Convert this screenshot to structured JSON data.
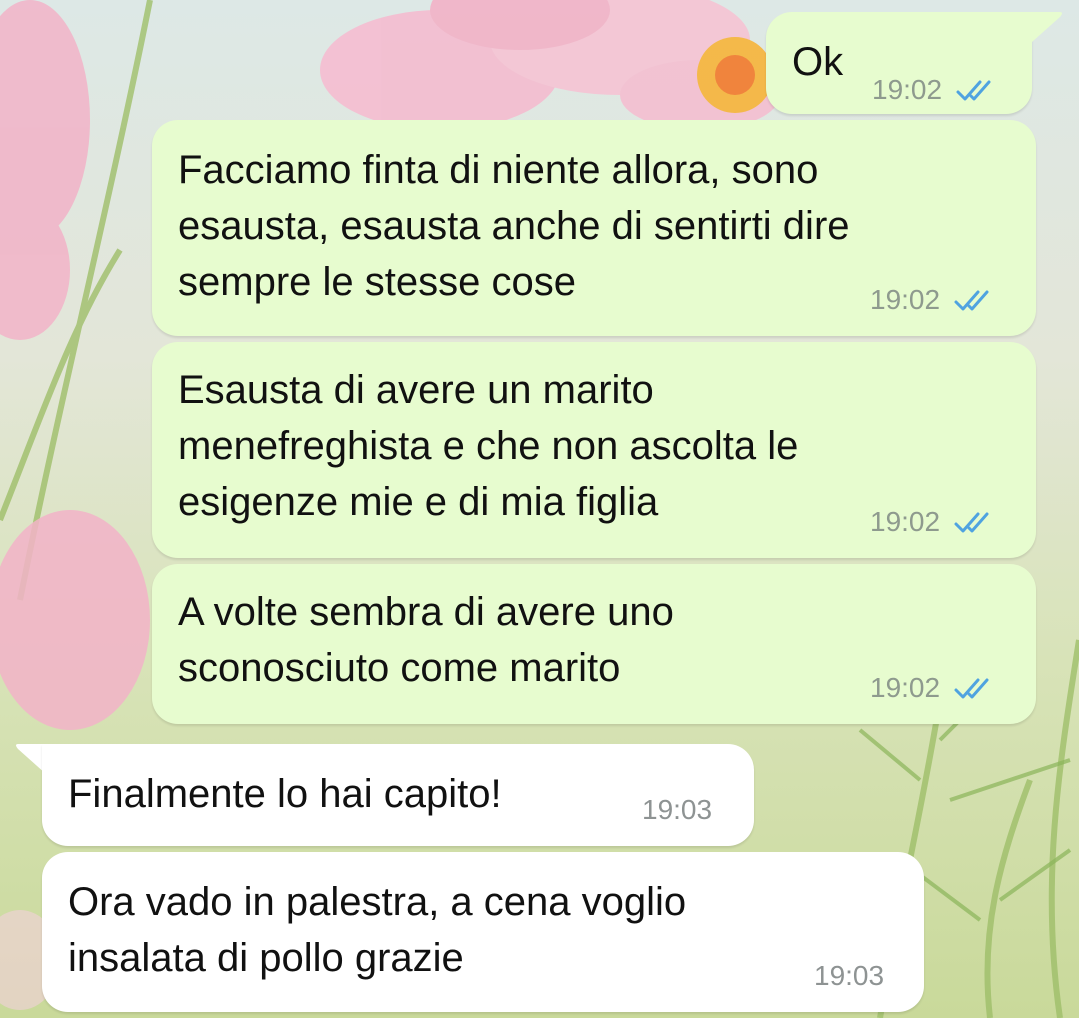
{
  "theme": {
    "outgoing_bubble": "#e7fccf",
    "incoming_bubble": "#ffffff",
    "read_ticks": "#4fa3e0"
  },
  "messages": [
    {
      "direction": "outgoing",
      "text": "Ok",
      "time": "19:02",
      "status": "read",
      "status_icon": "double-check-icon"
    },
    {
      "direction": "outgoing",
      "text": "Facciamo finta di niente allora, sono\nesausta, esausta anche di sentirti dire\nsempre le stesse cose",
      "time": "19:02",
      "status": "read",
      "status_icon": "double-check-icon"
    },
    {
      "direction": "outgoing",
      "text": "Esausta di avere un marito\nmenefreghista e che non ascolta le\nesigenze mie e di mia figlia",
      "time": "19:02",
      "status": "read",
      "status_icon": "double-check-icon"
    },
    {
      "direction": "outgoing",
      "text": "A volte sembra di avere uno\nsconosciuto come marito",
      "time": "19:02",
      "status": "read",
      "status_icon": "double-check-icon"
    },
    {
      "direction": "incoming",
      "text": "Finalmente lo hai capito!",
      "time": "19:03"
    },
    {
      "direction": "incoming",
      "text": "Ora vado in palestra, a cena voglio\ninsalata di pollo grazie",
      "time": "19:03"
    }
  ]
}
